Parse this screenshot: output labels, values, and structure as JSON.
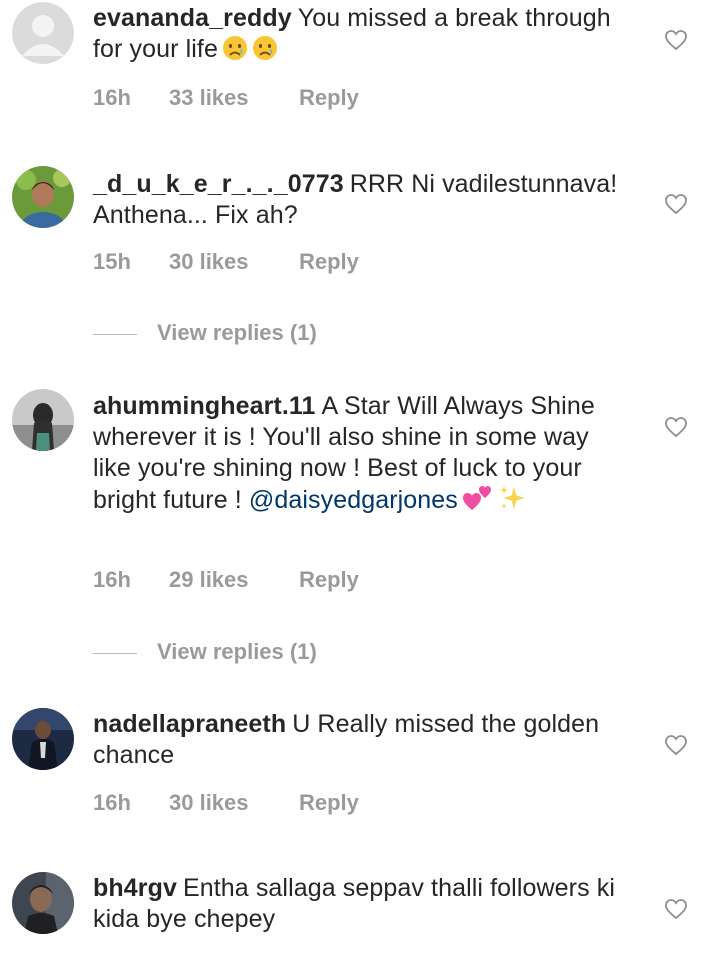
{
  "comments": [
    {
      "username": "evananda_reddy",
      "text": "You missed a break through for your life",
      "emoji": "crying-face-icon",
      "time": "16h",
      "likes": "33 likes",
      "reply": "Reply"
    },
    {
      "username": "_d_u_k_e_r_._._0773",
      "text": "RRR Ni vadilestunnava! Anthena... Fix ah?",
      "time": "15h",
      "likes": "30 likes",
      "reply": "Reply",
      "view_replies": "View replies (1)"
    },
    {
      "username": "ahummingheart.11",
      "text": "A Star Will Always Shine wherever it is ! You'll also shine in some way like you're shining now ! Best of luck to your bright future !",
      "mention": "@daisyedgarjones",
      "time": "16h",
      "likes": "29 likes",
      "reply": "Reply",
      "view_replies": "View replies (1)"
    },
    {
      "username": "nadellapraneeth",
      "text": "U Really missed the golden chance",
      "time": "16h",
      "likes": "30 likes",
      "reply": "Reply"
    },
    {
      "username": "bh4rgv",
      "text": "Entha sallaga seppav thalli followers ki kida bye chepey"
    }
  ],
  "colors": {
    "text": "#262626",
    "meta": "#9a9a9a",
    "mention": "#00376b",
    "heart": "#8e8e8e"
  }
}
